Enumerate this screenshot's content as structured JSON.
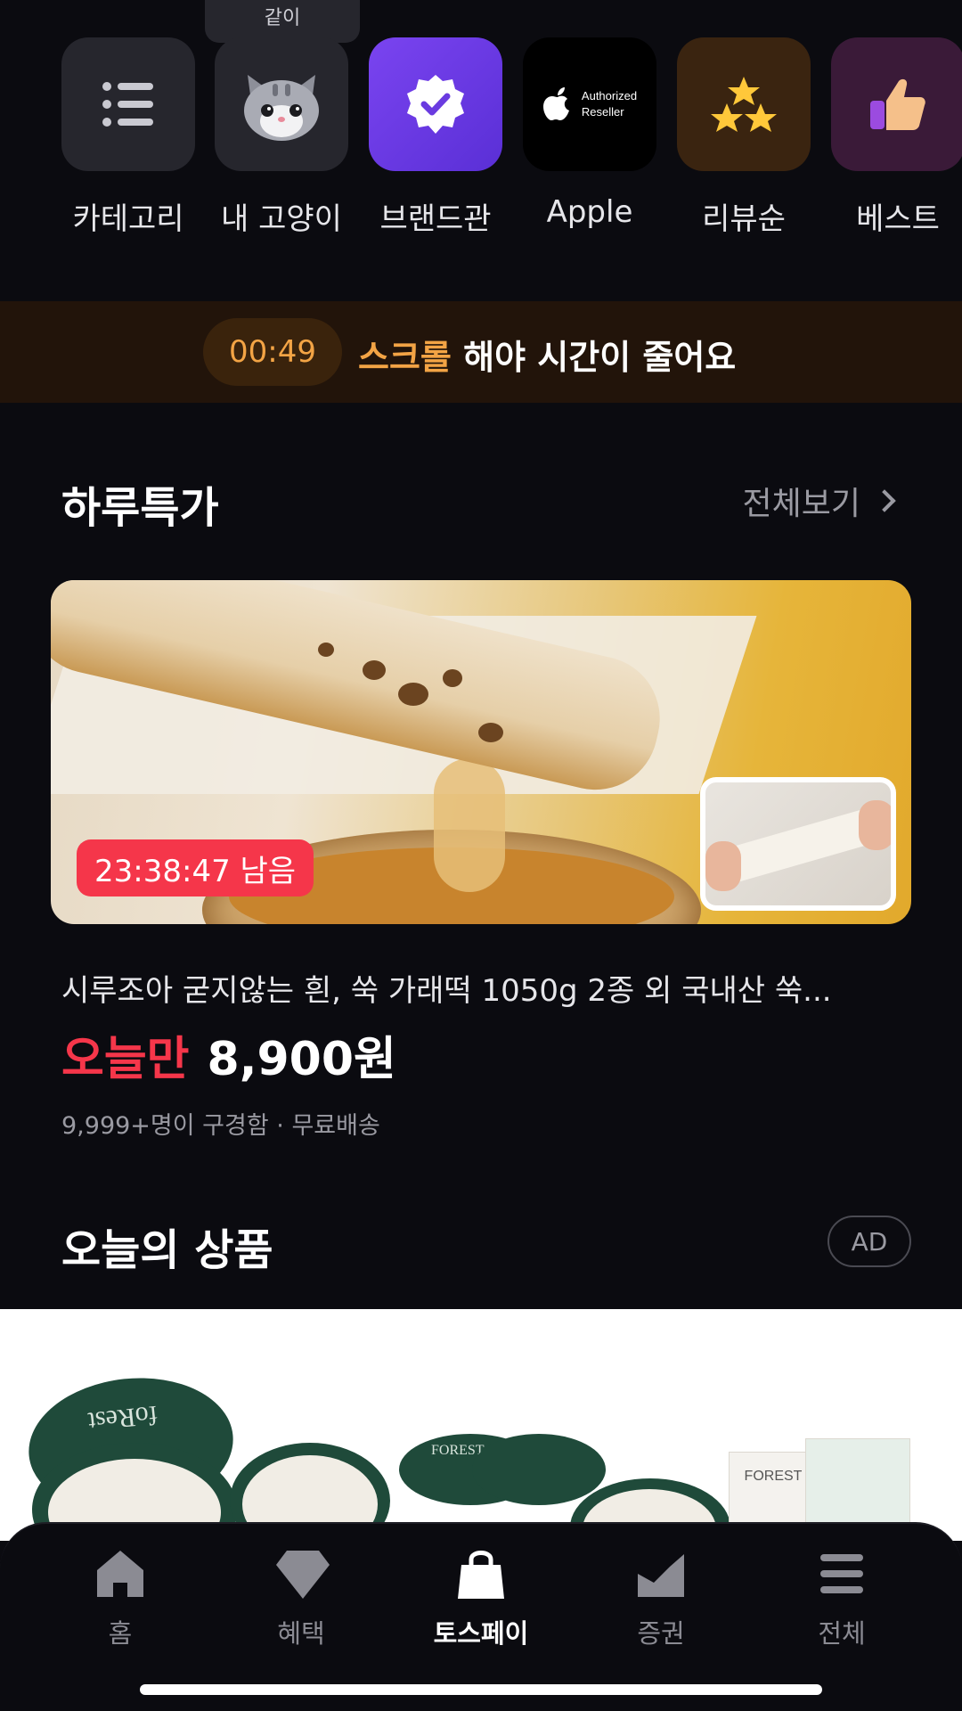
{
  "tooltip": {
    "text": "같이"
  },
  "shortcuts": [
    {
      "label": "카테고리",
      "icon": "list-icon",
      "color": "#26262d"
    },
    {
      "label": "내 고양이",
      "icon": "cat-face-icon",
      "color": "#26262d"
    },
    {
      "label": "브랜드관",
      "icon": "verified-badge-icon",
      "color": "#6a3be0"
    },
    {
      "label": "Apple",
      "icon": "apple-logo-icon",
      "color": "#000000",
      "tile_text_1": "Authorized",
      "tile_text_2": "Reseller"
    },
    {
      "label": "리뷰순",
      "icon": "stars-icon",
      "color": "#3a2410"
    },
    {
      "label": "베스트",
      "icon": "thumbs-up-icon",
      "color": "#3a1a38"
    }
  ],
  "banner": {
    "timer": "00:49",
    "highlight": "스크롤",
    "text": " 해야 시간이 줄어요",
    "accent": "#f3a445"
  },
  "daily_deal": {
    "title": "하루특가",
    "see_all": "전체보기",
    "countdown": "23:38:47 남음",
    "product_name": "시루조아 굳지않는 흰, 쑥 가래떡 1050g 2종 외 국내산 쑥...",
    "price_tag": "오늘만",
    "price": "8,900원",
    "meta": "9,999+명이 구경함 · 무료배송"
  },
  "todays_products": {
    "title": "오늘의 상품",
    "ad_label": "AD",
    "brand_text_1": "foRest",
    "brand_text_2": "FOREST",
    "brand_text_3": "FOREST"
  },
  "tabs": [
    {
      "label": "홈",
      "icon": "home-icon",
      "active": false
    },
    {
      "label": "혜택",
      "icon": "diamond-icon",
      "active": false
    },
    {
      "label": "토스페이",
      "icon": "shopping-bag-icon",
      "active": true
    },
    {
      "label": "증권",
      "icon": "chart-icon",
      "active": false
    },
    {
      "label": "전체",
      "icon": "menu-icon",
      "active": false
    }
  ],
  "colors": {
    "background": "#0b0b10",
    "price_red": "#f5364a",
    "muted": "#9a9aa2"
  }
}
